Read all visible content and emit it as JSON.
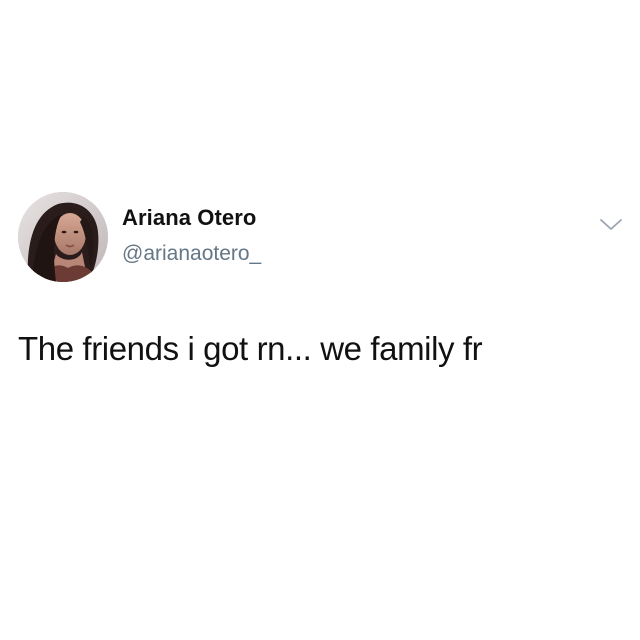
{
  "tweet": {
    "author": {
      "display_name": "Ariana Otero",
      "handle": "@arianaotero_",
      "avatar_icon": "user-avatar-photo"
    },
    "body": "The friends i got rn... we family fr",
    "menu_icon": "chevron-down-icon"
  },
  "colors": {
    "background": "#ffffff",
    "text": "#111111",
    "handle": "#657786",
    "chevron": "#9aa6b2"
  }
}
